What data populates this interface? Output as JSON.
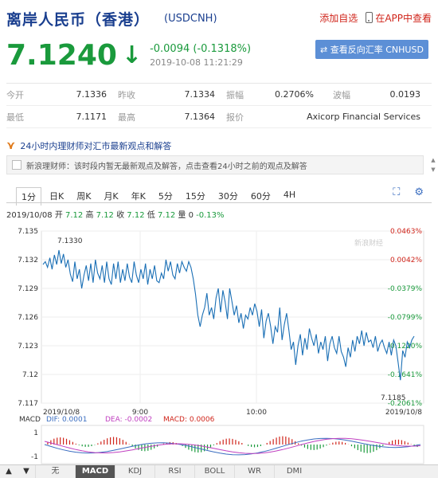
{
  "header": {
    "title": "离岸人民币（香港）",
    "code": "(USDCNH)",
    "add_watch": "添加自选",
    "app_view": "在APP中查看"
  },
  "quote": {
    "price": "7.1240",
    "change": "-0.0094 (-0.1318%)",
    "time": "2019-10-08 11:21:29",
    "reverse_button": "⇄ 查看反向汇率 CNHUSD",
    "trend_color": "#1a9a3c"
  },
  "stats": {
    "row1": [
      {
        "label": "今开",
        "value": "7.1336"
      },
      {
        "label": "昨收",
        "value": "7.1334"
      },
      {
        "label": "振幅",
        "value": "0.2706%"
      },
      {
        "label": "波幅",
        "value": "0.0193"
      }
    ],
    "row2": [
      {
        "label": "最低",
        "value": "7.1171"
      },
      {
        "label": "最高",
        "value": "7.1364"
      },
      {
        "label": "报价",
        "value": ""
      },
      {
        "label": "",
        "value": "Axicorp Financial Services"
      }
    ]
  },
  "news": {
    "heading": "24小时内理财师对汇市最新观点和解答",
    "message": "新浪理财师：该时段内暂无最新观点及解答，点击查看24小时之前的观点及解答",
    "icon": "spark-icon"
  },
  "period_tabs": [
    "1分",
    "日K",
    "周K",
    "月K",
    "年K",
    "5分",
    "15分",
    "30分",
    "60分",
    "4H"
  ],
  "active_period": "1分",
  "chart_icons": [
    "fullscreen-icon",
    "settings-icon"
  ],
  "info_bar": {
    "date": "2019/10/08",
    "open_label": "开",
    "open": "7.12",
    "high_label": "高",
    "high": "7.12",
    "close_label": "收",
    "close": "7.12",
    "low_label": "低",
    "low": "7.12",
    "vol_label": "量",
    "vol": "0",
    "pct": "-0.13%"
  },
  "chart_data": {
    "type": "line",
    "x_labels": [
      "2019/10/8",
      "9:00",
      "10:00",
      "2019/10/8"
    ],
    "y_ticks": [
      "7.135",
      "7.132",
      "7.129",
      "7.126",
      "7.123",
      "7.12",
      "7.117"
    ],
    "pct_ticks": [
      "0.0463%",
      "0.0042%",
      "-0.0379%",
      "-0.0799%",
      "-0.1220%",
      "-0.1641%",
      "-0.2061%"
    ],
    "ylim": [
      7.117,
      7.135
    ],
    "max_label": "7.1330",
    "min_label": "7.1185",
    "watermark": "新浪财经",
    "values": [
      7.1315,
      7.1318,
      7.1312,
      7.1322,
      7.131,
      7.1325,
      7.1315,
      7.133,
      7.1316,
      7.1326,
      7.1312,
      7.132,
      7.1305,
      7.1297,
      7.1318,
      7.13,
      7.131,
      7.129,
      7.1304,
      7.1314,
      7.1298,
      7.1316,
      7.1296,
      7.132,
      7.1306,
      7.13,
      7.1314,
      7.1296,
      7.1318,
      7.13,
      7.1294,
      7.1316,
      7.13,
      7.1318,
      7.1296,
      7.131,
      7.1298,
      7.1316,
      7.1302,
      7.1296,
      7.1318,
      7.1304,
      7.1296,
      7.131,
      7.13,
      7.1316,
      7.1294,
      7.131,
      7.13,
      7.1314,
      7.1298,
      7.1296,
      7.1306,
      7.13,
      7.132,
      7.1308,
      7.1318,
      7.1304,
      7.13,
      7.1316,
      7.1306,
      7.1318,
      7.1312,
      7.1308,
      7.1318,
      7.1312,
      7.13,
      7.1284,
      7.1262,
      7.125,
      7.1262,
      7.127,
      7.1285,
      7.1262,
      7.127,
      7.1258,
      7.128,
      7.129,
      7.1265,
      7.1288,
      7.1276,
      7.1258,
      7.129,
      7.1276,
      7.1262,
      7.1272,
      7.1254,
      7.1264,
      7.1248,
      7.1262,
      7.1258,
      7.127,
      7.1262,
      7.1274,
      7.1266,
      7.125,
      7.1268,
      7.1238,
      7.1256,
      7.1264,
      7.125,
      7.1232,
      7.125,
      7.1244,
      7.127,
      7.1236,
      7.1252,
      7.1264,
      7.1246,
      7.1226,
      7.1234,
      7.121,
      7.123,
      7.1242,
      7.122,
      7.1238,
      7.1226,
      7.1248,
      7.1238,
      7.123,
      7.1242,
      7.1222,
      7.1234,
      7.1226,
      7.124,
      7.1214,
      7.1232,
      7.124,
      7.1228,
      7.1222,
      7.124,
      7.1224,
      7.1218,
      7.1208,
      7.1228,
      7.1218,
      7.1236,
      7.1224,
      7.124,
      7.1232,
      7.1246,
      7.123,
      7.1244,
      7.1234,
      7.1236,
      7.1228,
      7.124,
      7.1224,
      7.1232,
      7.1236,
      7.1228,
      7.1222,
      7.1234,
      7.122,
      7.1236,
      7.123,
      7.1212,
      7.1194,
      7.1225,
      7.1218,
      7.1234,
      7.1228,
      7.1236,
      7.124
    ],
    "macd": {
      "label": "MACD",
      "dif": "DIF: 0.0001",
      "dea": "DEA: -0.0002",
      "macd": "MACD: 0.0006",
      "y_ticks": [
        "1",
        "-1"
      ]
    }
  },
  "bottom_tabs": [
    "无",
    "MACD",
    "KDJ",
    "RSI",
    "BOLL",
    "WR",
    "DMI"
  ],
  "active_bottom_tab": "MACD",
  "colors": {
    "title": "#1a3f8f",
    "up": "#d0251b",
    "down": "#1a9a3c",
    "line": "#1a6fb5"
  }
}
